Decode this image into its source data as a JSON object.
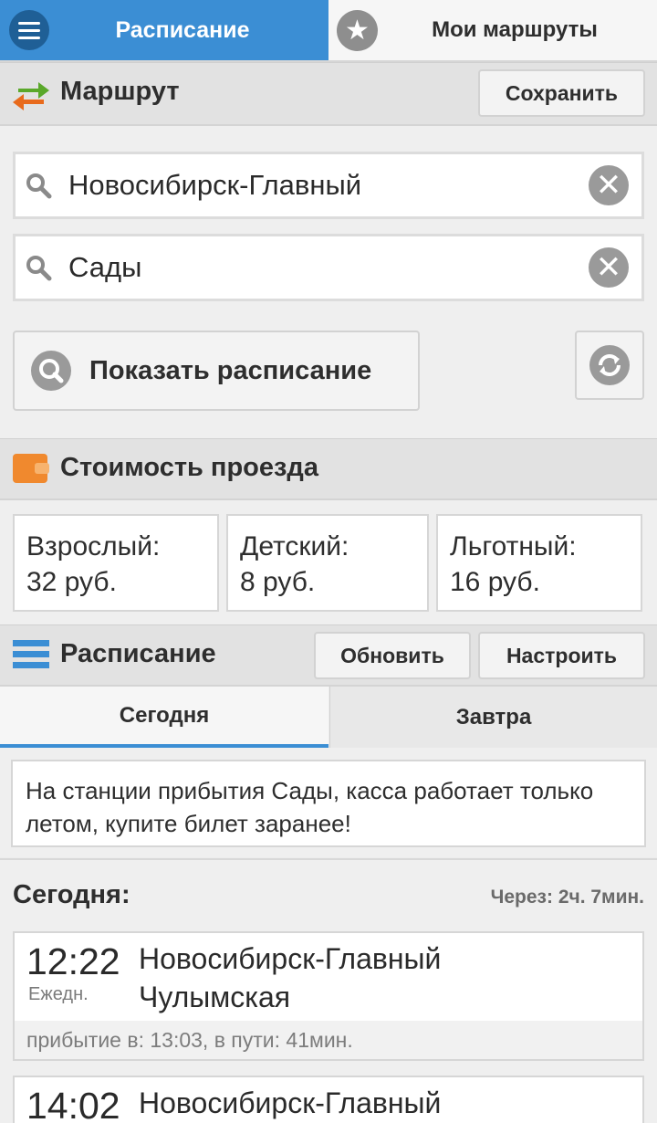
{
  "top_tabs": {
    "schedule_label": "Расписание",
    "my_routes_label": "Мои маршруты",
    "menu_icon": "menu-icon",
    "star_icon": "star-icon"
  },
  "route": {
    "title": "Маршрут",
    "save_label": "Сохранить",
    "from_value": "Новосибирск-Главный",
    "to_value": "Сады",
    "show_schedule_label": "Показать расписание"
  },
  "fare": {
    "title": "Стоимость проезда",
    "items": [
      {
        "label": "Взрослый:",
        "price": "32 руб."
      },
      {
        "label": "Детский:",
        "price": "8 руб."
      },
      {
        "label": "Льготный:",
        "price": "16 руб."
      }
    ]
  },
  "schedule": {
    "title": "Расписание",
    "refresh_label": "Обновить",
    "settings_label": "Настроить",
    "tabs": [
      {
        "label": "Сегодня",
        "active": true
      },
      {
        "label": "Завтра",
        "active": false
      }
    ],
    "notice": "На станции прибытия Сады, касса работает только летом, купите билет заранее!",
    "day_heading": "Сегодня:",
    "countdown": "Через: 2ч. 7мин.",
    "trains": [
      {
        "time": "12:22",
        "days": "Ежедн.",
        "from": "Новосибирск-Главный",
        "to": "Чулымская",
        "arrival": "прибытие в: 13:03, в пути: 41мин."
      },
      {
        "time": "14:02",
        "days": "",
        "from": "Новосибирск-Главный",
        "to": "",
        "arrival": ""
      }
    ]
  },
  "colors": {
    "accent_blue": "#3b8ed4",
    "dark_blue": "#1f5f96",
    "wallet_orange": "#f0892e",
    "route_arrow_green": "#5aa82a",
    "route_arrow_orange": "#e86a1c"
  }
}
